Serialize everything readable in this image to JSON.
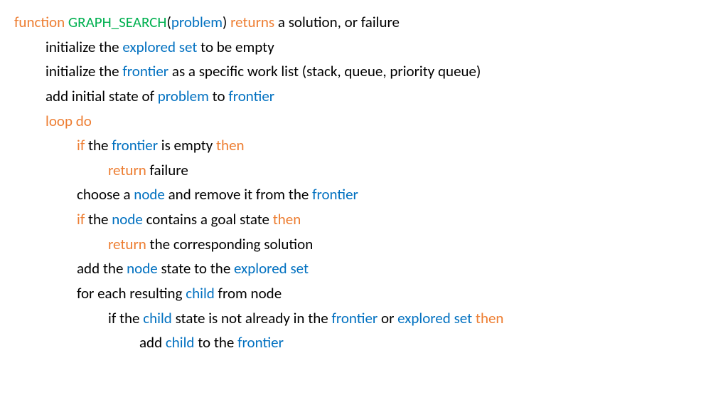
{
  "l1": {
    "function": "function",
    "name": "GRAPH_SEARCH",
    "paren_open": "(",
    "param": "problem",
    "paren_close": ")",
    "returns": "returns",
    "rest": " a solution, or failure"
  },
  "l2": {
    "t1": "initialize the ",
    "explored_set": "explored set",
    "t2": " to be empty"
  },
  "l3": {
    "t1": "initialize the ",
    "frontier": "frontier",
    "t2": " as a specific work list (stack, queue, priority queue)"
  },
  "l4": {
    "t1": "add initial state of ",
    "problem": "problem",
    "t2": " to ",
    "frontier": "frontier"
  },
  "l5": {
    "loop_do": "loop do"
  },
  "l6": {
    "if": "if",
    "t1": " the ",
    "frontier": "frontier",
    "t2": " is empty ",
    "then": "then"
  },
  "l7": {
    "return": "return",
    "t1": " failure"
  },
  "l8": {
    "t1": "choose a ",
    "node": "node",
    "t2": " and remove it from the ",
    "frontier": "frontier"
  },
  "l9": {
    "if": "if",
    "t1": " the ",
    "node": "node",
    "t2": " contains a goal state ",
    "then": "then"
  },
  "l10": {
    "return": "return",
    "t1": " the corresponding solution"
  },
  "l11": {
    "t1": "add the ",
    "node": "node",
    "t2": " state to the ",
    "explored_set": "explored set"
  },
  "l12": {
    "t1": "for each resulting ",
    "child": "child",
    "t2": " from node"
  },
  "l13": {
    "t1": "if the ",
    "child": "child",
    "t2": " state is not already in the ",
    "frontier": "frontier",
    "t3": " or ",
    "explored_set": "explored set",
    "t4": " ",
    "then": "then"
  },
  "l14": {
    "t1": "add ",
    "child": "child",
    "t2": " to the ",
    "frontier": "frontier"
  }
}
